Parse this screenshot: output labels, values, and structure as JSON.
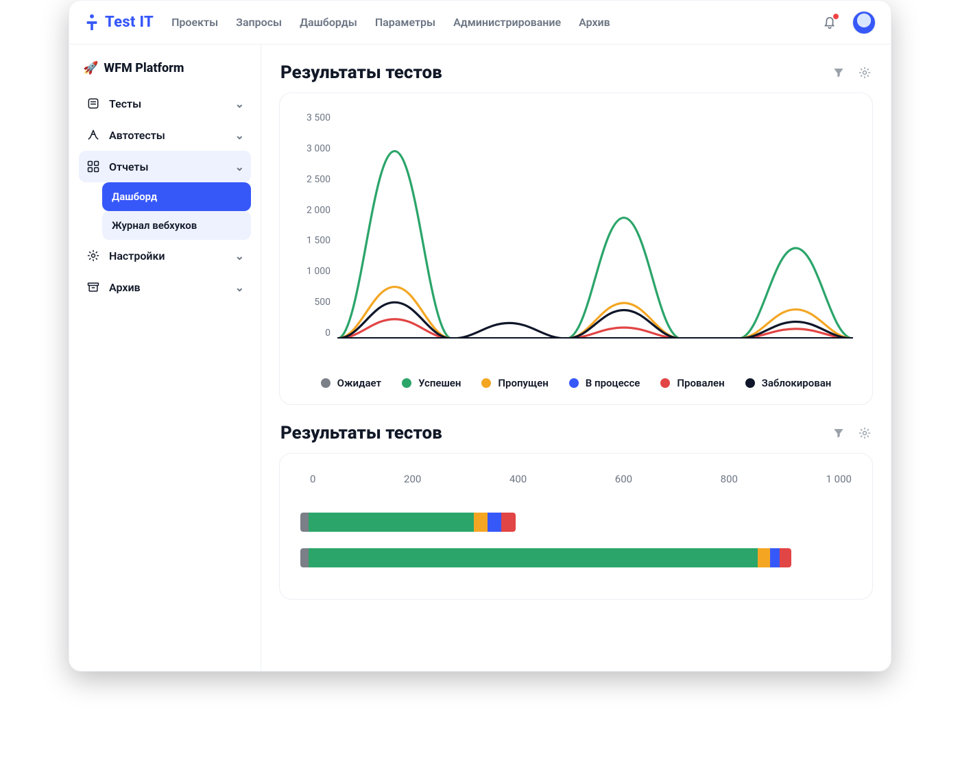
{
  "app_name": "Test IT",
  "topnav": [
    "Проекты",
    "Запросы",
    "Дашборды",
    "Параметры",
    "Администрирование",
    "Архив"
  ],
  "project_name": "WFM Platform",
  "sidebar": [
    {
      "id": "tests",
      "label": "Тесты"
    },
    {
      "id": "autotests",
      "label": "Автотесты"
    },
    {
      "id": "reports",
      "label": "Отчеты",
      "expanded": true,
      "children": [
        {
          "id": "dashboard",
          "label": "Дашборд",
          "active": true
        },
        {
          "id": "webhooks",
          "label": "Журнал вебхуков"
        }
      ]
    },
    {
      "id": "settings",
      "label": "Настройки"
    },
    {
      "id": "archive",
      "label": "Архив"
    }
  ],
  "colors": {
    "pending": "#7b7f87",
    "passed": "#2ba56a",
    "skipped": "#f4a623",
    "inprogress": "#3758f9",
    "failed": "#e24545",
    "blocked": "#10172a"
  },
  "section1": {
    "title": "Результаты тестов",
    "y_ticks": [
      "3 500",
      "3 000",
      "2 500",
      "2 000",
      "1 500",
      "1 000",
      "500",
      "0"
    ],
    "legend": [
      {
        "key": "pending",
        "label": "Ожидает"
      },
      {
        "key": "passed",
        "label": "Успешен"
      },
      {
        "key": "skipped",
        "label": "Пропущен"
      },
      {
        "key": "inprogress",
        "label": "В процессе"
      },
      {
        "key": "failed",
        "label": "Провален"
      },
      {
        "key": "blocked",
        "label": "Заблокирован"
      }
    ]
  },
  "section2": {
    "title": "Результаты тестов",
    "x_ticks": [
      "0",
      "200",
      "400",
      "600",
      "800",
      "1 000"
    ]
  },
  "chart_data": [
    {
      "type": "line",
      "title": "Результаты тестов",
      "ylabel": "",
      "ylim": [
        0,
        3500
      ],
      "x": [
        0,
        1,
        2,
        3,
        4,
        5,
        6,
        7,
        8,
        9
      ],
      "series": [
        {
          "name": "Ожидает",
          "color": "pending",
          "values": [
            0,
            0,
            0,
            0,
            0,
            0,
            0,
            0,
            0,
            0
          ]
        },
        {
          "name": "Успешен",
          "color": "passed",
          "values": [
            0,
            2900,
            0,
            0,
            0,
            1870,
            0,
            0,
            1400,
            0
          ]
        },
        {
          "name": "Пропущен",
          "color": "skipped",
          "values": [
            0,
            800,
            0,
            0,
            0,
            550,
            0,
            0,
            450,
            0
          ]
        },
        {
          "name": "В процессе",
          "color": "inprogress",
          "values": [
            0,
            0,
            0,
            0,
            0,
            0,
            0,
            0,
            0,
            0
          ]
        },
        {
          "name": "Провален",
          "color": "failed",
          "values": [
            0,
            300,
            0,
            0,
            0,
            170,
            0,
            0,
            150,
            0
          ]
        },
        {
          "name": "Заблокирован",
          "color": "blocked",
          "values": [
            0,
            560,
            0,
            240,
            0,
            440,
            0,
            0,
            260,
            0
          ]
        }
      ]
    },
    {
      "type": "bar",
      "orientation": "horizontal",
      "stacked": true,
      "title": "Результаты тестов",
      "xlim": [
        0,
        1000
      ],
      "rows": [
        {
          "segments": [
            {
              "key": "pending",
              "value": 15
            },
            {
              "key": "passed",
              "value": 300
            },
            {
              "key": "skipped",
              "value": 25
            },
            {
              "key": "inprogress",
              "value": 25
            },
            {
              "key": "failed",
              "value": 25
            }
          ]
        },
        {
          "segments": [
            {
              "key": "pending",
              "value": 15
            },
            {
              "key": "passed",
              "value": 815
            },
            {
              "key": "skipped",
              "value": 22
            },
            {
              "key": "inprogress",
              "value": 18
            },
            {
              "key": "failed",
              "value": 20
            }
          ]
        }
      ]
    }
  ]
}
